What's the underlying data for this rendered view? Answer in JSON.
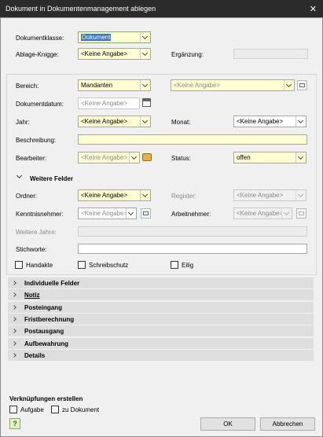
{
  "window": {
    "title": "Dokument in Dokumentenmanagement ablegen",
    "close_glyph": "✕"
  },
  "top": {
    "dokumentklasse_label": "Dokumentklasse:",
    "dokumentklasse_value": "Dokument",
    "ablage_knigge_label": "Ablage-Knigge:",
    "ablage_knigge_value": "<Keine Angabe>",
    "ergaenzung_label": "Ergänzung:"
  },
  "form": {
    "bereich_label": "Bereich:",
    "bereich_value": "Mandanten",
    "bereich2_value": "<Keine Angabe>",
    "dokumentdatum_label": "Dokumentdatum:",
    "dokumentdatum_value": "<Keine Angabe>",
    "jahr_label": "Jahr:",
    "jahr_value": "<Keine Angabe>",
    "monat_label": "Monat:",
    "monat_value": "<Keine Angabe>",
    "beschreibung_label": "Beschreibung:",
    "bearbeiter_label": "Bearbeiter:",
    "bearbeiter_value": "<Keine Angabe>",
    "status_label": "Status:",
    "status_value": "offen"
  },
  "weitere": {
    "title": "Weitere Felder",
    "ordner_label": "Ordner:",
    "ordner_value": "<Keine Angabe>",
    "register_label": "Register:",
    "register_value": "<Keine Angabe>",
    "kenntnisnehmer_label": "Kenntnisnehmer:",
    "kenntnisnehmer_value": "<Keine Angabe>",
    "arbeitnehmer_label": "Arbeitnehmer:",
    "arbeitnehmer_value": "<Keine Angabe>",
    "weitere_jahre_label": "Weitere Jahre:",
    "stichworte_label": "Stichworte:",
    "handakte_label": "Handakte",
    "schreibschutz_label": "Schreibschutz",
    "eilig_label": "Eilig"
  },
  "sections": [
    {
      "label": "Individuelle Felder"
    },
    {
      "label": "Notiz"
    },
    {
      "label": "Posteingang"
    },
    {
      "label": "Fristberechnung"
    },
    {
      "label": "Postausgang"
    },
    {
      "label": "Aufbewahrung"
    },
    {
      "label": "Details"
    }
  ],
  "links": {
    "title": "Verknüpfungen erstellen",
    "aufgabe_label": "Aufgabe",
    "zu_dokument_label": "zu Dokument"
  },
  "buttons": {
    "ok": "OK",
    "abbrechen": "Abbrechen",
    "help_glyph": "?"
  }
}
